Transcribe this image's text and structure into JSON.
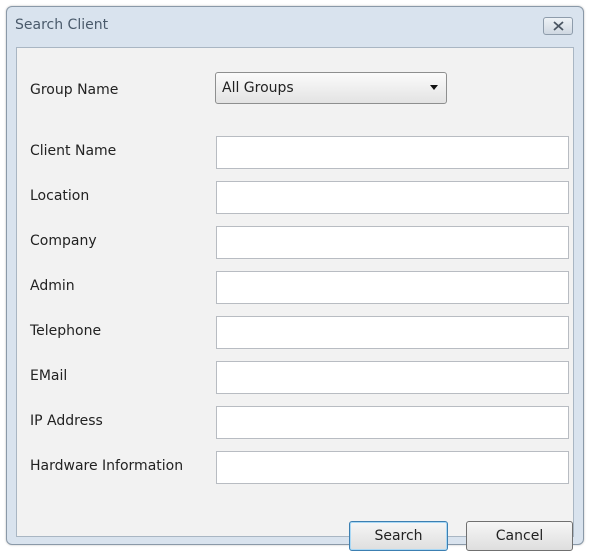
{
  "window": {
    "title": "Search Client",
    "close_icon": "close-x-icon"
  },
  "form": {
    "group_name": {
      "label": "Group Name",
      "selected": "All Groups"
    },
    "fields": [
      {
        "label": "Client Name",
        "value": ""
      },
      {
        "label": "Location",
        "value": ""
      },
      {
        "label": "Company",
        "value": ""
      },
      {
        "label": "Admin",
        "value": ""
      },
      {
        "label": "Telephone",
        "value": ""
      },
      {
        "label": "EMail",
        "value": ""
      },
      {
        "label": "IP Address",
        "value": ""
      },
      {
        "label": "Hardware Information",
        "value": ""
      }
    ]
  },
  "buttons": {
    "search_label": "Search",
    "cancel_label": "Cancel"
  },
  "colors": {
    "frame": "#d9e3ee",
    "client": "#f2f2f2",
    "primary_border": "#3c7fb1"
  }
}
